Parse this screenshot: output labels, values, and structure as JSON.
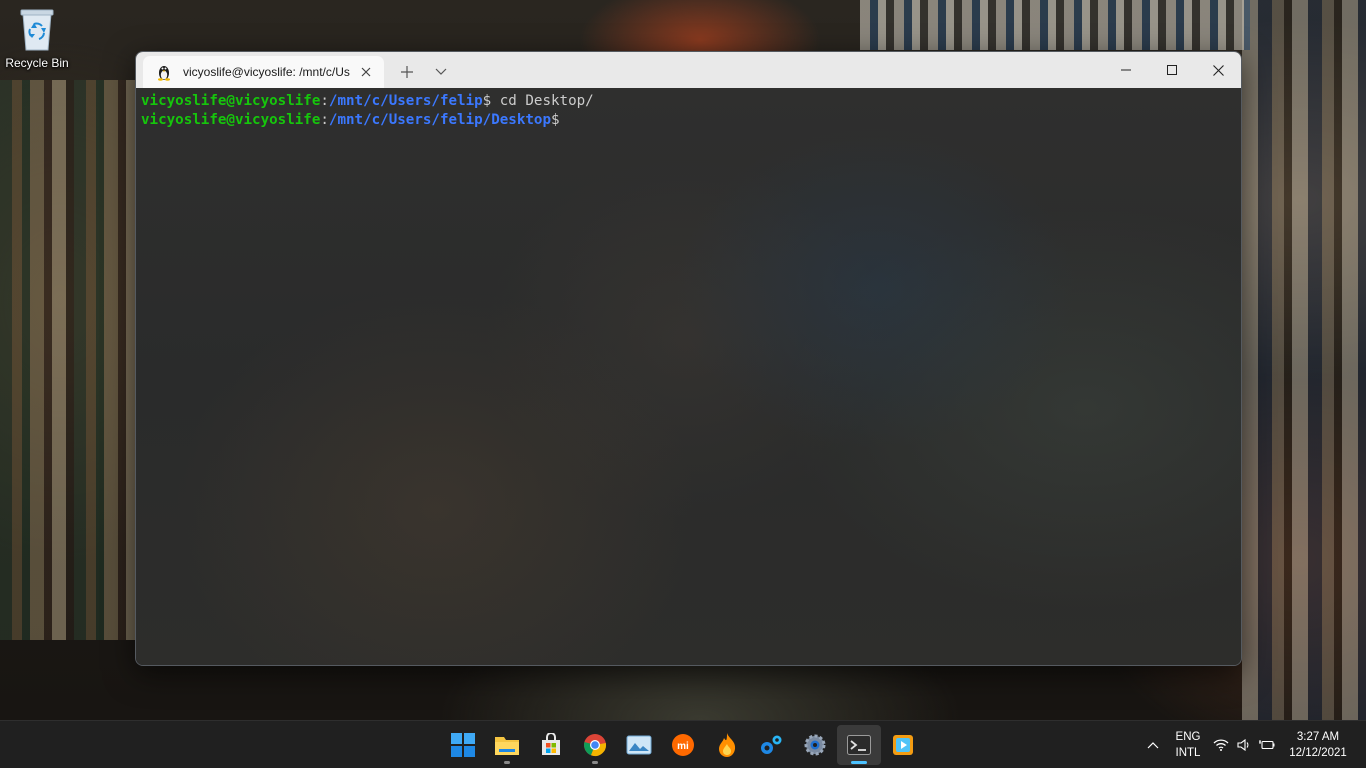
{
  "desktop": {
    "icons": [
      {
        "label": "Recycle Bin",
        "icon": "recycle-bin-icon"
      }
    ]
  },
  "window": {
    "tab": {
      "title": "vicyoslife@vicyoslife: /mnt/c/Us",
      "icon": "linux-penguin-icon"
    },
    "new_tab_icon": "plus-icon",
    "dropdown_icon": "chevron-down-icon",
    "controls": [
      "minimize-icon",
      "maximize-icon",
      "close-icon"
    ]
  },
  "terminal": {
    "colors": {
      "user_host": "#16c60c",
      "path": "#3b78ff",
      "text": "#cccccc",
      "background": "#2c2c2c"
    },
    "lines": [
      {
        "user_host": "vicyoslife@vicyoslife",
        "sep": ":",
        "path": "/mnt/c/Users/felip",
        "prompt": "$",
        "command": " cd Desktop/"
      },
      {
        "user_host": "vicyoslife@vicyoslife",
        "sep": ":",
        "path": "/mnt/c/Users/felip/Desktop",
        "prompt": "$",
        "command": ""
      }
    ]
  },
  "taskbar": {
    "apps": [
      {
        "name": "start",
        "icon": "windows-start-icon"
      },
      {
        "name": "file-explorer",
        "icon": "folder-icon"
      },
      {
        "name": "microsoft-store",
        "icon": "store-icon"
      },
      {
        "name": "chrome",
        "icon": "chrome-icon"
      },
      {
        "name": "photos",
        "icon": "photos-icon"
      },
      {
        "name": "mi",
        "icon": "mi-icon"
      },
      {
        "name": "flame-app",
        "icon": "flame-icon"
      },
      {
        "name": "gears-app",
        "icon": "gears-icon"
      },
      {
        "name": "settings",
        "icon": "settings-gear-icon"
      },
      {
        "name": "terminal",
        "icon": "terminal-icon",
        "active": true
      },
      {
        "name": "media-player",
        "icon": "media-player-icon"
      }
    ],
    "tray": {
      "overflow_icon": "chevron-up-icon",
      "language": {
        "line1": "ENG",
        "line2": "INTL"
      },
      "icons": [
        "wifi-icon",
        "volume-icon",
        "battery-icon"
      ],
      "time": "3:27 AM",
      "date": "12/12/2021"
    }
  }
}
